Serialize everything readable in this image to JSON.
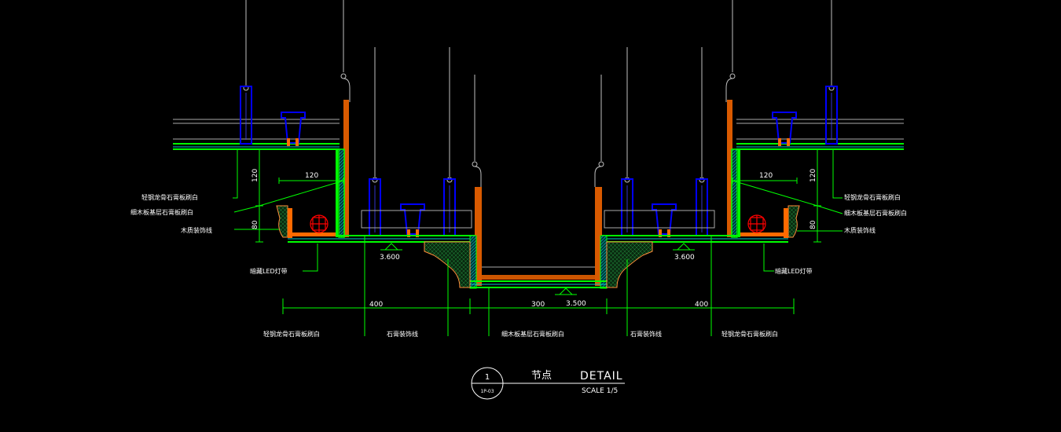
{
  "drawing": {
    "levels": {
      "left": "3.600",
      "center": "3.500",
      "right": "3.600"
    },
    "dims": {
      "h120_left": "120",
      "h80_left": "80",
      "w120_left": "120",
      "h120_right": "120",
      "h80_right": "80",
      "w120_right": "120",
      "bottom_left": "400",
      "bottom_center": "300",
      "bottom_right": "400"
    },
    "labels": {
      "left_top": "轻钢龙骨石膏板刷白",
      "left_mid": "细木板基层石膏板刷白",
      "left_low": "木质装饰线",
      "left_led": "暗藏LED灯带",
      "bot_1": "轻钢龙骨石膏板刷白",
      "bot_2": "石膏装饰线",
      "bot_3": "细木板基层石膏板刷白",
      "bot_4": "石膏装饰线",
      "bot_5": "轻钢龙骨石膏板刷白",
      "right_led": "暗藏LED灯带",
      "right_top": "轻钢龙骨石膏板刷白",
      "right_mid": "细木板基层石膏板刷白",
      "right_low": "木质装饰线"
    },
    "title": {
      "number": "1",
      "sheet": "1P-03",
      "cn": "节点",
      "en": "DETAIL",
      "scale": "SCALE 1/5"
    }
  },
  "colors": {
    "background": "#000000",
    "board": "#00ff00",
    "hatch": "#00c8c8",
    "wood": "#ff6a00",
    "metal": "#0000ff",
    "hanger": "#c0c0c0",
    "lamp": "#ff0000",
    "text": "#ffffff"
  }
}
